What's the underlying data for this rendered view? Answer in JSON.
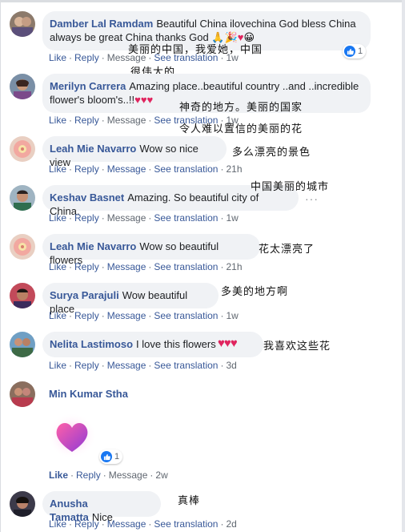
{
  "actions": {
    "like": "Like",
    "reply": "Reply",
    "message": "Message",
    "see_translation": "See translation",
    "sep": "·"
  },
  "comments": [
    {
      "author": "Damber Lal Ramdam",
      "text_line1": "Beautiful China ilovechina God bless China",
      "text_line2": "always be great China thanks God",
      "time": "1w",
      "like_count": "1",
      "overlay_line1": "美丽的中国，我爱她，中国",
      "overlay_line2": "很伟大的"
    },
    {
      "author": "Merilyn Carrera",
      "text_line1": "Amazing place..beautiful country ..and ..incredible",
      "text_line2": "flower's bloom's..!!",
      "time": "1w",
      "overlay_line1": "神奇的地方。美丽的国家",
      "overlay_line2": "令人难以置信的美丽的花"
    },
    {
      "author": "Leah Mie Navarro",
      "text": "Wow so nice view",
      "time": "21h",
      "overlay": "多么漂亮的景色"
    },
    {
      "author": "Keshav Basnet",
      "text": "Amazing. So beautiful city of China.",
      "time": "1w",
      "overlay": "中国美丽的城市",
      "more": "···"
    },
    {
      "author": "Leah Mie Navarro",
      "text": "Wow so beautiful flowers",
      "time": "21h",
      "overlay": "花太漂亮了"
    },
    {
      "author": "Surya Parajuli",
      "text": "Wow beautiful place",
      "time": "1w",
      "overlay": "多美的地方啊"
    },
    {
      "author": "Nelita Lastimoso",
      "text": "I love this flowers",
      "time": "3d",
      "overlay": "我喜欢这些花"
    },
    {
      "author": "Min Kumar Stha",
      "time": "2w",
      "like_count": "1"
    },
    {
      "author": "Anusha Tamatta",
      "text": "Nice",
      "time": "2d",
      "overlay": "真棒"
    }
  ],
  "colors": {
    "link": "#385898",
    "bubble": "#f0f2f5",
    "muted": "#606770",
    "like_blue": "#1877f2",
    "heart_red": "#e0245e"
  }
}
